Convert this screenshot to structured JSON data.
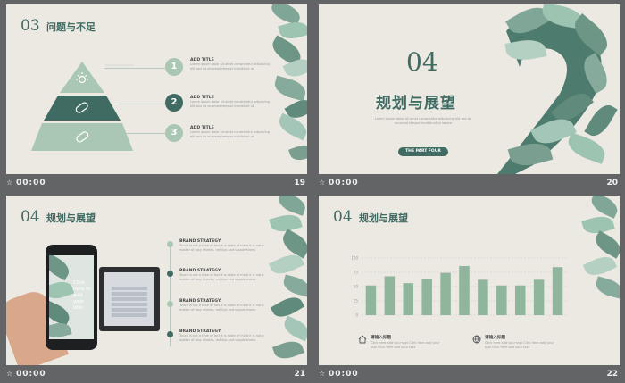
{
  "slides": [
    {
      "number": "19",
      "time": "00:00",
      "header_num": "03",
      "header_title": "问题与不足",
      "items": [
        {
          "num": "1",
          "title": "ADD TITLE",
          "text": "Lorem ipsum dolor sit amet consectetur adipiscing elit sed do eiusmod tempor incididunt ut"
        },
        {
          "num": "2",
          "title": "ADD TITLE",
          "text": "Lorem ipsum dolor sit amet consectetur adipiscing elit sed do eiusmod tempor incididunt ut"
        },
        {
          "num": "3",
          "title": "ADD TITLE",
          "text": "Lorem ipsum dolor sit amet consectetur adipiscing elit sed do eiusmod tempor incididunt ut"
        }
      ]
    },
    {
      "number": "20",
      "time": "00:00",
      "big_num": "04",
      "title": "规划与展望",
      "subtitle": "Lorem ipsum dolor sit amet consectetur adipiscing elit sed do eiusmod tempor incididunt ut labore",
      "badge": "THE PART FOUR"
    },
    {
      "number": "21",
      "time": "00:00",
      "header_num": "04",
      "header_title": "规划与展望",
      "phone_text": "Click here to add your title",
      "items": [
        {
          "title": "BRAND STRATEGY",
          "text": "Touch is not a time of fact it is state of mind it is not a matter of rosy cheeks, red lips and supple knees"
        },
        {
          "title": "BRAND STRATEGY",
          "text": "Touch is not a time of fact it is state of mind it is not a matter of rosy cheeks, red lips and supple knees"
        },
        {
          "title": "BRAND STRATEGY",
          "text": "Touch is not a time of fact it is state of mind it is not a matter of rosy cheeks, red lips and supple knees"
        },
        {
          "title": "BRAND STRATEGY",
          "text": "Touch is not a time of fact it is state of mind it is not a matter of rosy cheeks, red lips and supple knees"
        }
      ]
    },
    {
      "number": "22",
      "time": "00:00",
      "header_num": "04",
      "header_title": "规划与展望",
      "notes": [
        {
          "title": "请输入标题",
          "text": "Click here add your text Click here add your text Click here add your text"
        },
        {
          "title": "请输入标题",
          "text": "Click here add your text Click here add your text Click here add your text"
        }
      ]
    }
  ],
  "chart_data": {
    "type": "bar",
    "ylim": [
      0,
      100
    ],
    "ytick_labels": [
      "100",
      "75",
      "50",
      "25",
      "0"
    ],
    "values": [
      52,
      68,
      56,
      64,
      74,
      86,
      62,
      52,
      52,
      62,
      84
    ],
    "color": "#8fb59c"
  },
  "colors": {
    "accent": "#3f6b62",
    "light_green": "#a9c7b3",
    "leaf_dark": "#4d7b6e",
    "leaf_light": "#9dc3b1",
    "bg": "#626466"
  }
}
